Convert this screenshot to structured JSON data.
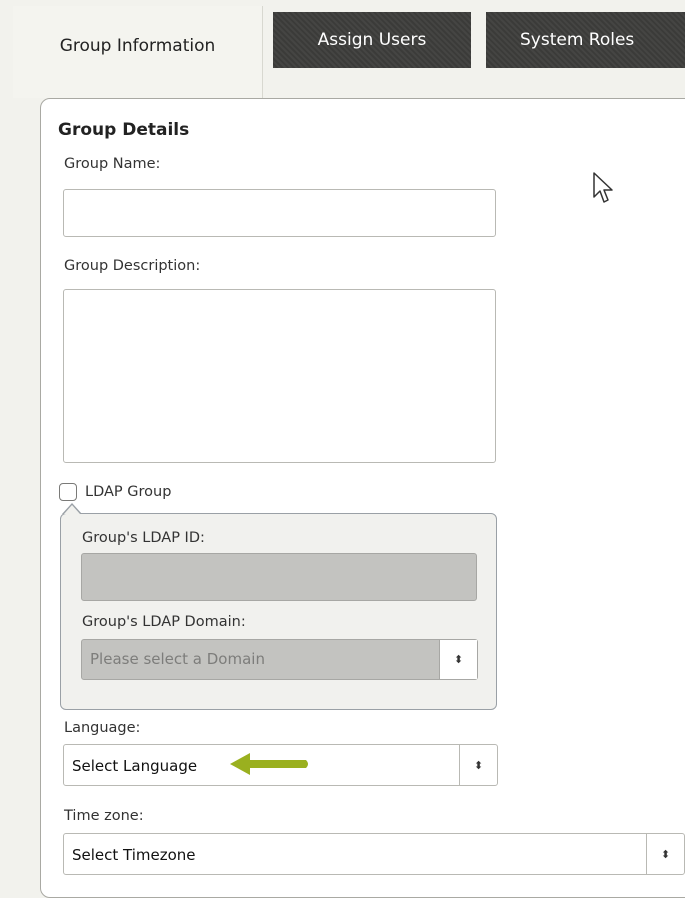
{
  "tabs": [
    {
      "label": "Group Information"
    },
    {
      "label": "Assign Users"
    },
    {
      "label": "System Roles"
    }
  ],
  "section": {
    "title": "Group Details"
  },
  "fields": {
    "group_name": {
      "label": "Group Name:",
      "value": ""
    },
    "group_description": {
      "label": "Group Description:",
      "value": ""
    },
    "ldap_group": {
      "label": "LDAP Group",
      "checked": false
    },
    "ldap_id": {
      "label": "Group's LDAP ID:",
      "value": ""
    },
    "ldap_domain": {
      "label": "Group's LDAP Domain:",
      "placeholder": "Please select a Domain"
    },
    "language": {
      "label": "Language:",
      "selected": "Select Language"
    },
    "timezone": {
      "label": "Time zone:",
      "selected": "Select Timezone"
    }
  },
  "annotation": {
    "arrow_color": "#9ab01f"
  },
  "colors": {
    "tab_active_bg": "#f4f4ef",
    "tab_inactive_bg": "#3b3b39",
    "disabled_bg": "#c3c3c0"
  }
}
